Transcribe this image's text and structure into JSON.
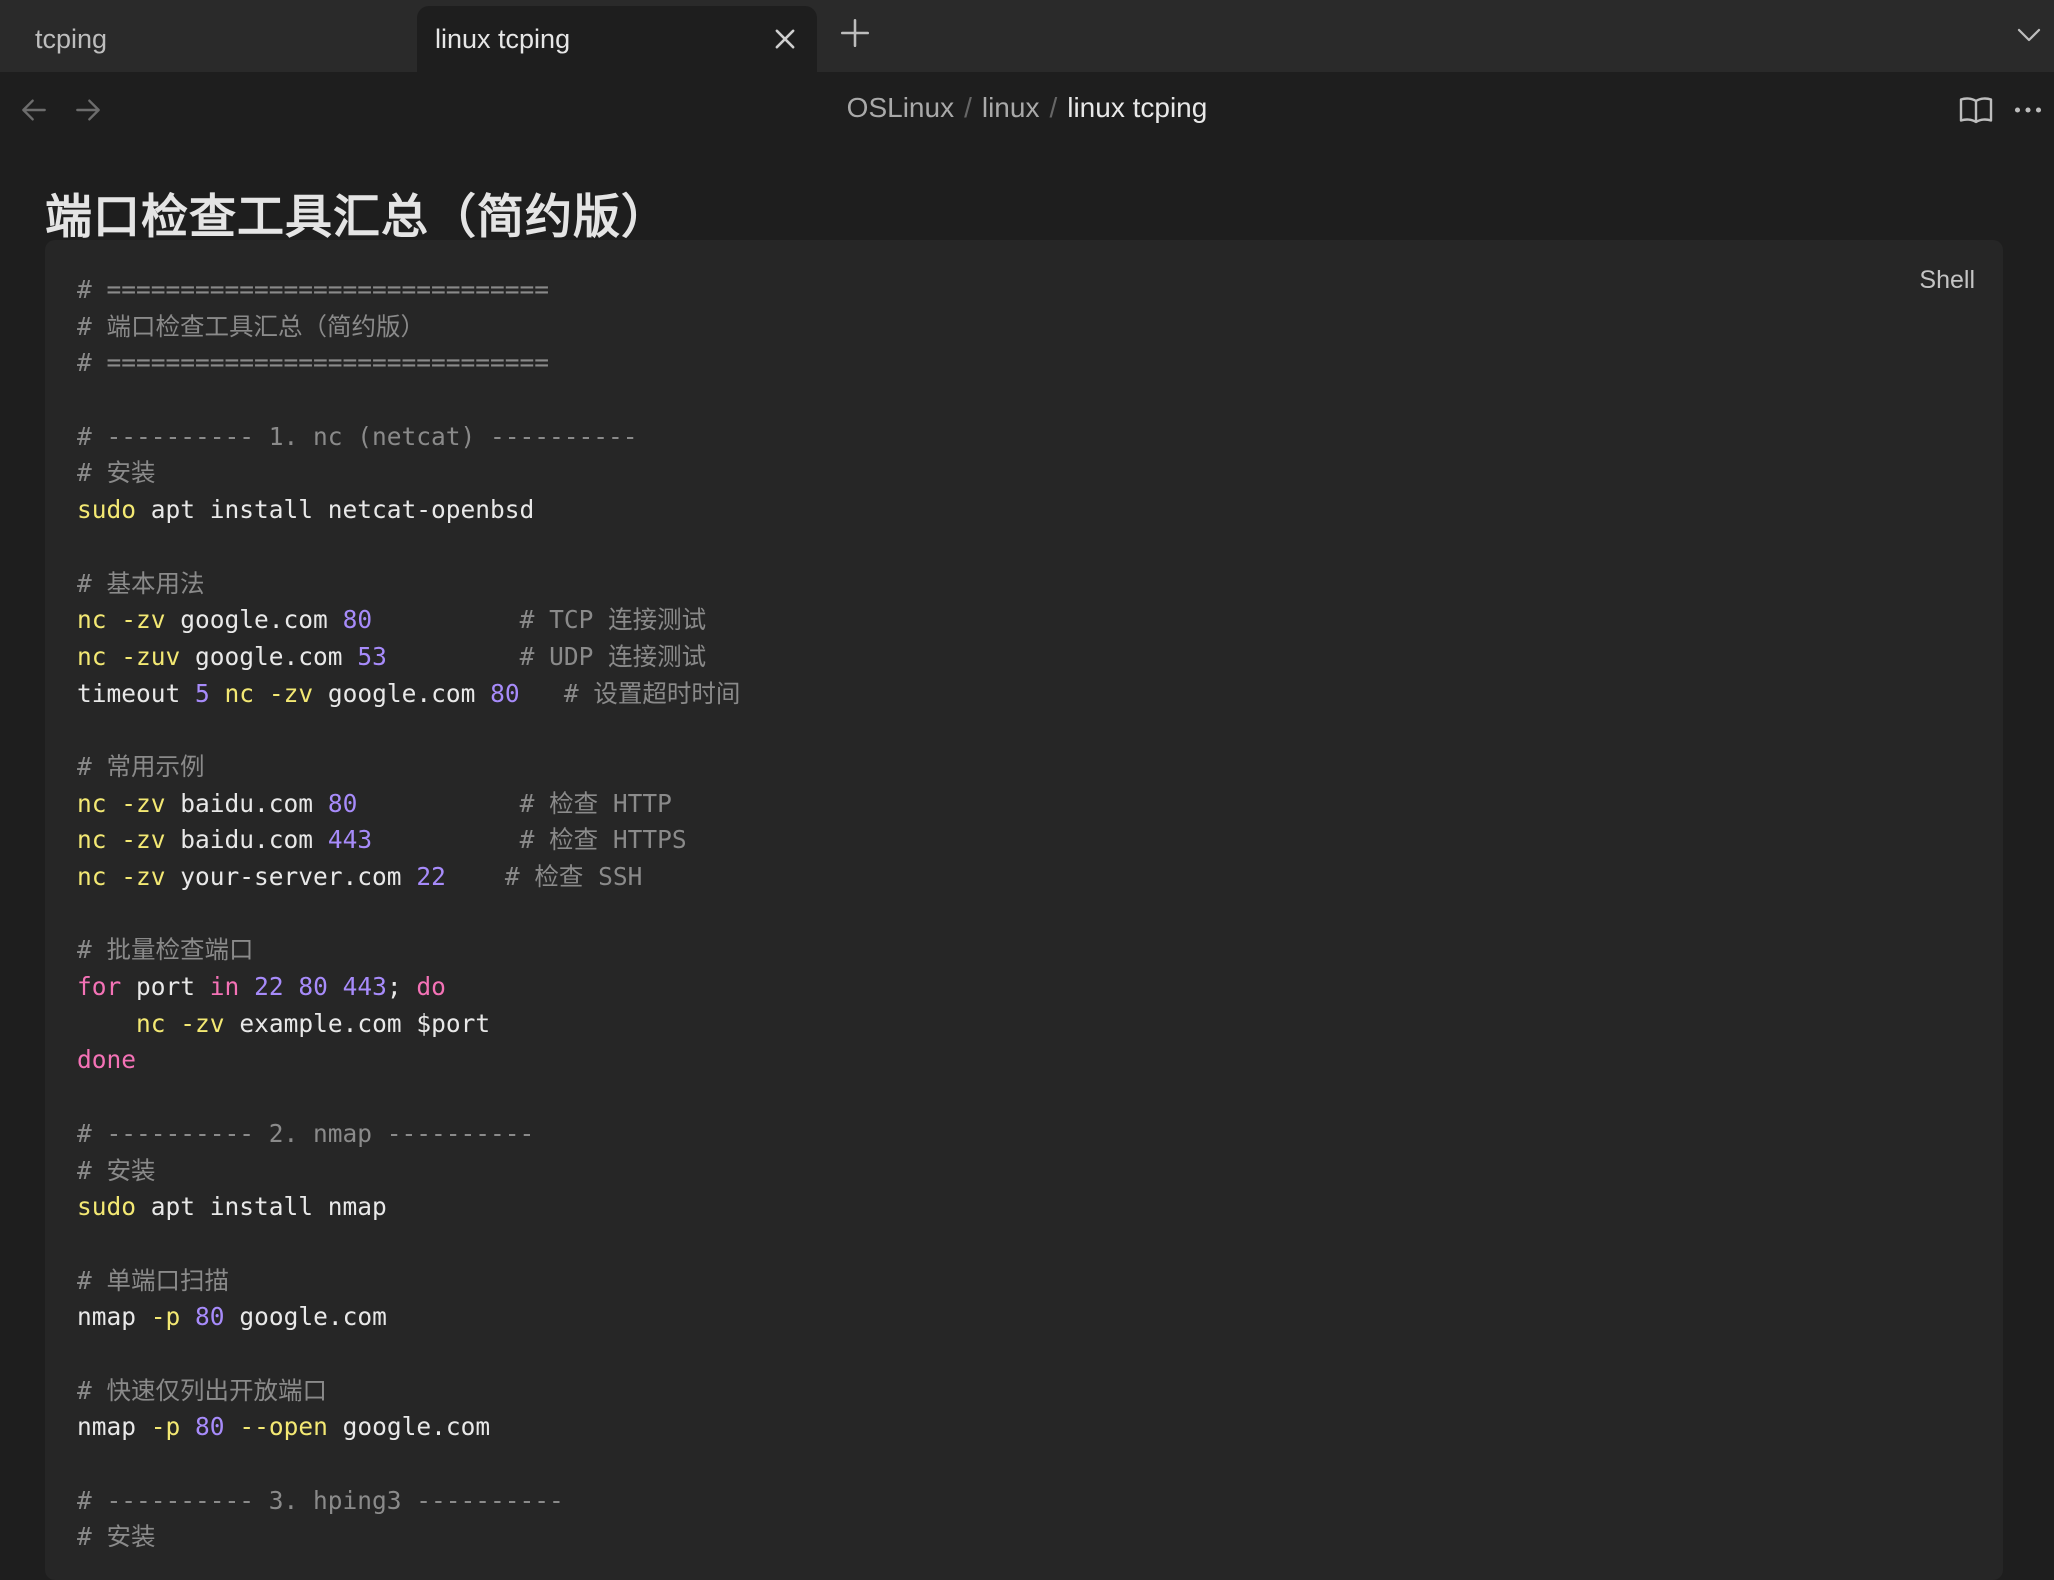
{
  "tabs": [
    {
      "label": "tcping",
      "active": false
    },
    {
      "label": "linux tcping",
      "active": true
    }
  ],
  "breadcrumb": [
    "OSLinux",
    "linux",
    "linux tcping"
  ],
  "icons": {
    "back": "arrow-left-icon",
    "forward": "arrow-right-icon",
    "reading_view": "book-open-icon",
    "more": "more-horizontal-icon",
    "close_tab": "close-icon",
    "new_tab": "plus-icon",
    "tab_list": "chevron-down-icon"
  },
  "colors": {
    "background": "#1e1e1e",
    "code_background": "#262626",
    "comment": "#8a8a8a",
    "keyword": "#f3e873",
    "number": "#a78bfa",
    "control": "#f472b6",
    "text": "#e8e8e8"
  },
  "page_title": "端口检查工具汇总（简约版）",
  "code_lang": "Shell",
  "code_lines": [
    [
      [
        "comment",
        "# =============================="
      ]
    ],
    [
      [
        "comment",
        "# 端口检查工具汇总（简约版）"
      ]
    ],
    [
      [
        "comment",
        "# =============================="
      ]
    ],
    [],
    [
      [
        "comment",
        "# ---------- 1. nc (netcat) ----------"
      ]
    ],
    [
      [
        "comment",
        "# 安装"
      ]
    ],
    [
      [
        "kw",
        "sudo"
      ],
      [
        "plain",
        " apt install netcat-openbsd"
      ]
    ],
    [],
    [
      [
        "comment",
        "# 基本用法"
      ]
    ],
    [
      [
        "kw",
        "nc"
      ],
      [
        "plain",
        " "
      ],
      [
        "kw",
        "-zv"
      ],
      [
        "plain",
        " google.com "
      ],
      [
        "num",
        "80"
      ],
      [
        "plain",
        "          "
      ],
      [
        "comment",
        "# TCP 连接测试"
      ]
    ],
    [
      [
        "kw",
        "nc"
      ],
      [
        "plain",
        " "
      ],
      [
        "kw",
        "-zuv"
      ],
      [
        "plain",
        " google.com "
      ],
      [
        "num",
        "53"
      ],
      [
        "plain",
        "         "
      ],
      [
        "comment",
        "# UDP 连接测试"
      ]
    ],
    [
      [
        "plain",
        "timeout "
      ],
      [
        "num",
        "5"
      ],
      [
        "plain",
        " "
      ],
      [
        "kw",
        "nc"
      ],
      [
        "plain",
        " "
      ],
      [
        "kw",
        "-zv"
      ],
      [
        "plain",
        " google.com "
      ],
      [
        "num",
        "80"
      ],
      [
        "plain",
        "   "
      ],
      [
        "comment",
        "# 设置超时时间"
      ]
    ],
    [],
    [
      [
        "comment",
        "# 常用示例"
      ]
    ],
    [
      [
        "kw",
        "nc"
      ],
      [
        "plain",
        " "
      ],
      [
        "kw",
        "-zv"
      ],
      [
        "plain",
        " baidu.com "
      ],
      [
        "num",
        "80"
      ],
      [
        "plain",
        "           "
      ],
      [
        "comment",
        "# 检查 HTTP"
      ]
    ],
    [
      [
        "kw",
        "nc"
      ],
      [
        "plain",
        " "
      ],
      [
        "kw",
        "-zv"
      ],
      [
        "plain",
        " baidu.com "
      ],
      [
        "num",
        "443"
      ],
      [
        "plain",
        "          "
      ],
      [
        "comment",
        "# 检查 HTTPS"
      ]
    ],
    [
      [
        "kw",
        "nc"
      ],
      [
        "plain",
        " "
      ],
      [
        "kw",
        "-zv"
      ],
      [
        "plain",
        " your-server.com "
      ],
      [
        "num",
        "22"
      ],
      [
        "plain",
        "    "
      ],
      [
        "comment",
        "# 检查 SSH"
      ]
    ],
    [],
    [
      [
        "comment",
        "# 批量检查端口"
      ]
    ],
    [
      [
        "ctl",
        "for"
      ],
      [
        "plain",
        " port "
      ],
      [
        "ctl",
        "in"
      ],
      [
        "plain",
        " "
      ],
      [
        "num",
        "22"
      ],
      [
        "plain",
        " "
      ],
      [
        "num",
        "80"
      ],
      [
        "plain",
        " "
      ],
      [
        "num",
        "443"
      ],
      [
        "plain",
        "; "
      ],
      [
        "ctl",
        "do"
      ]
    ],
    [
      [
        "plain",
        "    "
      ],
      [
        "kw",
        "nc"
      ],
      [
        "plain",
        " "
      ],
      [
        "kw",
        "-zv"
      ],
      [
        "plain",
        " example.com $port"
      ]
    ],
    [
      [
        "ctl",
        "done"
      ]
    ],
    [],
    [
      [
        "comment",
        "# ---------- 2. nmap ----------"
      ]
    ],
    [
      [
        "comment",
        "# 安装"
      ]
    ],
    [
      [
        "kw",
        "sudo"
      ],
      [
        "plain",
        " apt install nmap"
      ]
    ],
    [],
    [
      [
        "comment",
        "# 单端口扫描"
      ]
    ],
    [
      [
        "plain",
        "nmap "
      ],
      [
        "kw",
        "-p"
      ],
      [
        "plain",
        " "
      ],
      [
        "num",
        "80"
      ],
      [
        "plain",
        " google.com"
      ]
    ],
    [],
    [
      [
        "comment",
        "# 快速仅列出开放端口"
      ]
    ],
    [
      [
        "plain",
        "nmap "
      ],
      [
        "kw",
        "-p"
      ],
      [
        "plain",
        " "
      ],
      [
        "num",
        "80"
      ],
      [
        "plain",
        " "
      ],
      [
        "kw",
        "--open"
      ],
      [
        "plain",
        " google.com"
      ]
    ],
    [],
    [
      [
        "comment",
        "# ---------- 3. hping3 ----------"
      ]
    ],
    [
      [
        "comment",
        "# 安装"
      ]
    ]
  ]
}
